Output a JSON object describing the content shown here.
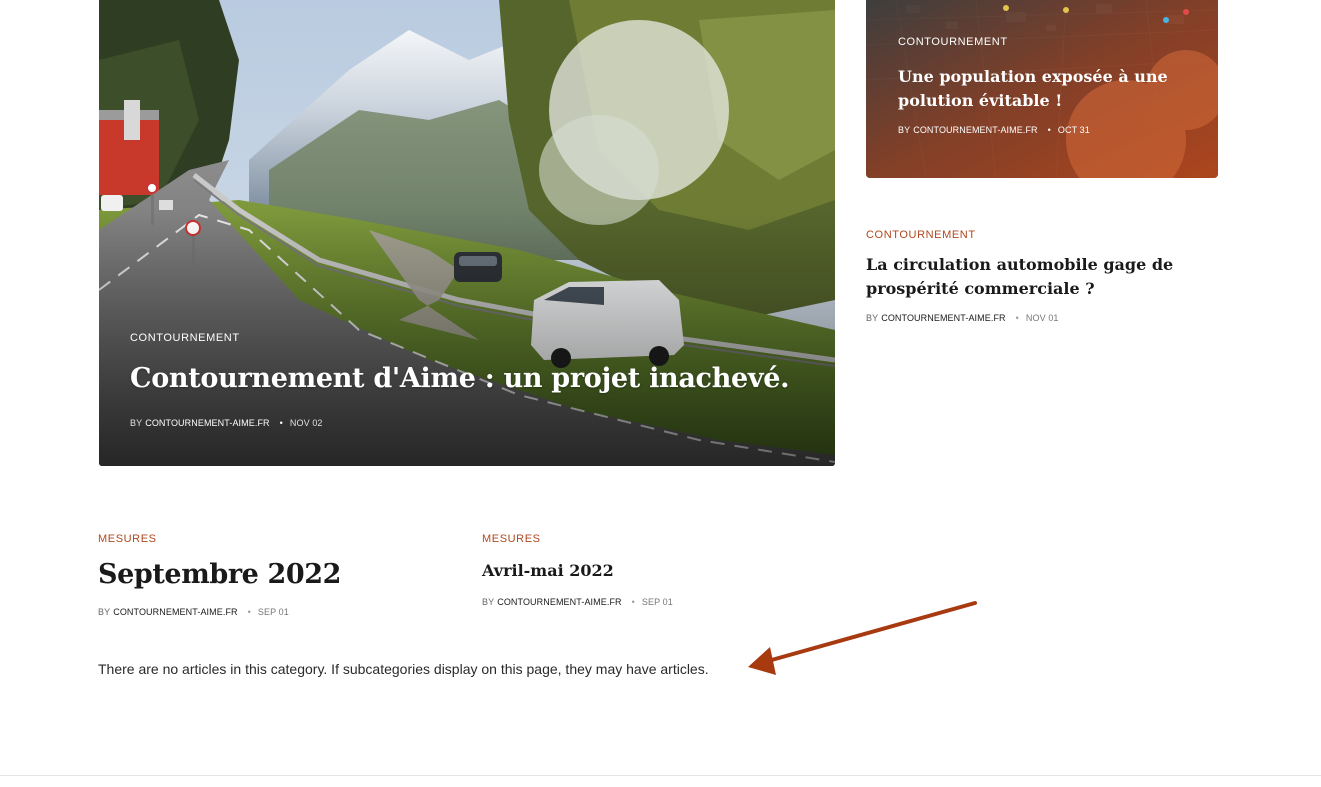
{
  "hero": {
    "category": "CONTOURNEMENT",
    "title": "Contournement d'Aime : un projet inachevé.",
    "by": "BY",
    "author": "CONTOURNEMENT-AIME.FR",
    "date": "NOV 02"
  },
  "card_top_right": {
    "category": "CONTOURNEMENT",
    "title": "Une population exposée à une polution évitable !",
    "by": "BY",
    "author": "CONTOURNEMENT-AIME.FR",
    "date": "OCT 31"
  },
  "post_right": {
    "category": "CONTOURNEMENT",
    "title": "La circulation automobile gage de prospérité commerciale ?",
    "by": "BY",
    "author": "CONTOURNEMENT-AIME.FR",
    "date": "NOV 01"
  },
  "post_septembre": {
    "category": "MESURES",
    "title": "Septembre 2022",
    "by": "BY",
    "author": "CONTOURNEMENT-AIME.FR",
    "date": "SEP 01"
  },
  "post_avril": {
    "category": "MESURES",
    "title": "Avril-mai 2022",
    "by": "BY",
    "author": "CONTOURNEMENT-AIME.FR",
    "date": "SEP 01"
  },
  "notice": "There are no articles in this category. If subcategories display on this page, they may have articles.",
  "colors": {
    "accent": "#b0481f",
    "arrow": "#a83a10",
    "text": "#1a1a1a"
  }
}
